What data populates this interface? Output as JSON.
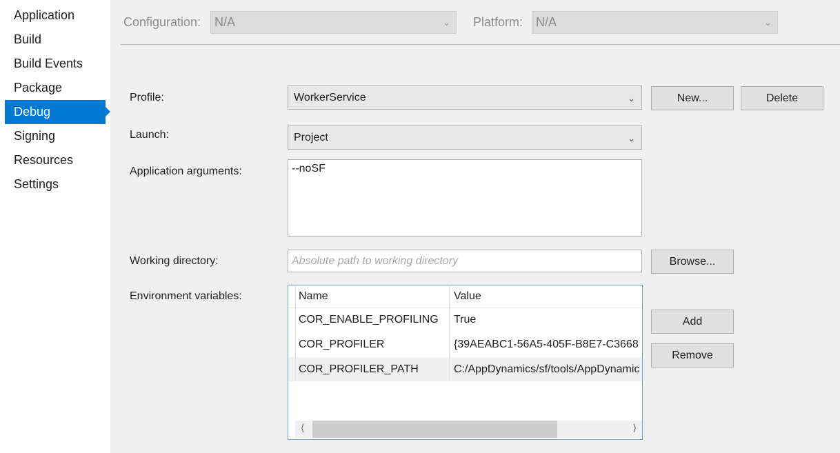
{
  "sidebar": {
    "items": [
      {
        "label": "Application"
      },
      {
        "label": "Build"
      },
      {
        "label": "Build Events"
      },
      {
        "label": "Package"
      },
      {
        "label": "Debug"
      },
      {
        "label": "Signing"
      },
      {
        "label": "Resources"
      },
      {
        "label": "Settings"
      }
    ],
    "active": "Debug"
  },
  "config_bar": {
    "configuration_label": "Configuration:",
    "configuration_value": "N/A",
    "platform_label": "Platform:",
    "platform_value": "N/A"
  },
  "form": {
    "profile_label": "Profile:",
    "profile_value": "WorkerService",
    "new_button": "New...",
    "delete_button": "Delete",
    "launch_label": "Launch:",
    "launch_value": "Project",
    "app_args_label": "Application arguments:",
    "app_args_value": "--noSF",
    "working_dir_label": "Working directory:",
    "working_dir_placeholder": "Absolute path to working directory",
    "browse_button": "Browse...",
    "env_label": "Environment variables:",
    "add_button": "Add",
    "remove_button": "Remove"
  },
  "env_grid": {
    "columns": [
      "Name",
      "Value"
    ],
    "rows": [
      {
        "name": "COR_ENABLE_PROFILING",
        "value": "True"
      },
      {
        "name": "COR_PROFILER",
        "value": "{39AEABC1-56A5-405F-B8E7-C3668"
      },
      {
        "name": "COR_PROFILER_PATH",
        "value": "C:/AppDynamics/sf/tools/AppDynamic"
      }
    ],
    "selected_row": 2
  },
  "colors": {
    "accent": "#0078d4",
    "panel_background": "#f0f0f0"
  }
}
